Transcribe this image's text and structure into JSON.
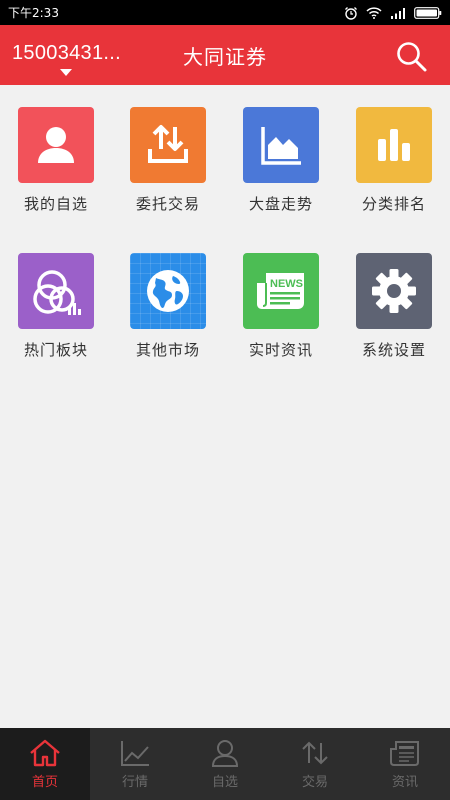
{
  "status": {
    "time": "下午2:33",
    "icons": [
      "alarm-icon",
      "wifi-icon",
      "signal-icon",
      "battery-icon"
    ]
  },
  "header": {
    "account": "15003431...",
    "title": "大同证券",
    "search_icon": "search-icon",
    "background": "#e8343a"
  },
  "grid": {
    "items": [
      {
        "label": "我的自选",
        "icon": "person-icon",
        "color": "#f2525a"
      },
      {
        "label": "委托交易",
        "icon": "trade-arrows-icon",
        "color": "#f07a32"
      },
      {
        "label": "大盘走势",
        "icon": "area-chart-icon",
        "color": "#4b78d8"
      },
      {
        "label": "分类排名",
        "icon": "bar-chart-icon",
        "color": "#f1b93f"
      },
      {
        "label": "热门板块",
        "icon": "sector-circles-icon",
        "color": "#9b60c9"
      },
      {
        "label": "其他市场",
        "icon": "globe-icon",
        "color": "#2b8de8"
      },
      {
        "label": "实时资讯",
        "icon": "news-icon",
        "color": "#4cbd54"
      },
      {
        "label": "系统设置",
        "icon": "gear-icon",
        "color": "#5e6373"
      }
    ]
  },
  "tabbar": {
    "items": [
      {
        "label": "首页",
        "icon": "home-icon",
        "active": true
      },
      {
        "label": "行情",
        "icon": "line-chart-icon",
        "active": false
      },
      {
        "label": "自选",
        "icon": "user-icon",
        "active": false
      },
      {
        "label": "交易",
        "icon": "exchange-icon",
        "active": false
      },
      {
        "label": "资讯",
        "icon": "newspaper-icon",
        "active": false
      }
    ],
    "active_color": "#e8343a"
  }
}
